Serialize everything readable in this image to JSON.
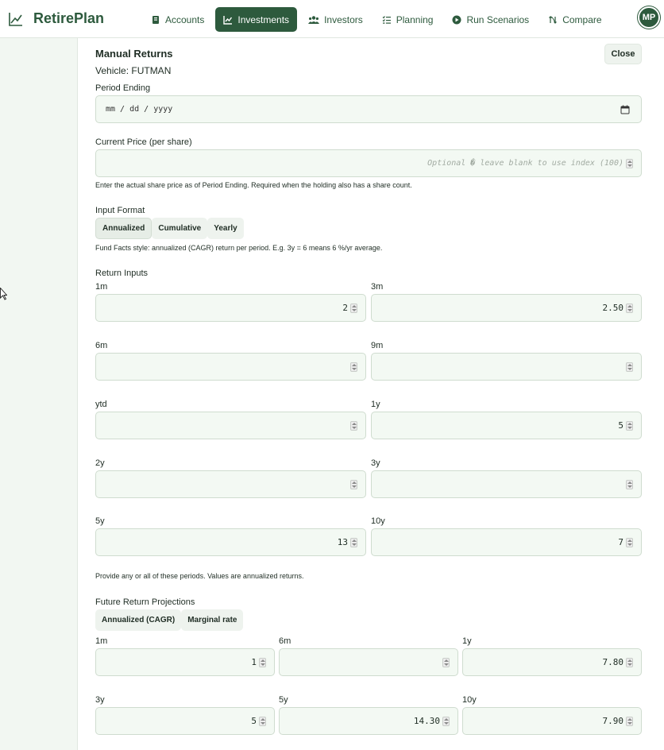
{
  "app": {
    "brand": "RetirePlan",
    "avatar_initials": "MP"
  },
  "nav": {
    "items": [
      {
        "label": "Accounts",
        "icon": "accounts-icon"
      },
      {
        "label": "Investments",
        "icon": "chart-icon",
        "active": true
      },
      {
        "label": "Investors",
        "icon": "users-icon"
      },
      {
        "label": "Planning",
        "icon": "checklist-icon"
      },
      {
        "label": "Run Scenarios",
        "icon": "play-icon"
      },
      {
        "label": "Compare",
        "icon": "compare-icon"
      }
    ]
  },
  "panel": {
    "title": "Manual Returns",
    "close_label": "Close",
    "vehicle": "Vehicle: FUTMAN",
    "period_ending": {
      "label": "Period Ending",
      "value": "mm / dd / yyyy"
    },
    "current_price": {
      "label": "Current Price (per share)",
      "placeholder": "Optional � leave blank to use index (100)",
      "help": "Enter the actual share price as of Period Ending. Required when the holding also has a share count."
    },
    "input_format": {
      "label": "Input Format",
      "options": [
        "Annualized",
        "Cumulative",
        "Yearly"
      ],
      "selected": "Annualized",
      "help": "Fund Facts style: annualized (CAGR) return per period. E.g. 3y = 6 means 6 %/yr average."
    },
    "return_inputs": {
      "label": "Return Inputs",
      "fields": [
        {
          "label": "1m",
          "value": "2"
        },
        {
          "label": "3m",
          "value": "2.50"
        },
        {
          "label": "6m",
          "value": ""
        },
        {
          "label": "9m",
          "value": ""
        },
        {
          "label": "ytd",
          "value": ""
        },
        {
          "label": "1y",
          "value": "5"
        },
        {
          "label": "2y",
          "value": ""
        },
        {
          "label": "3y",
          "value": ""
        },
        {
          "label": "5y",
          "value": "13"
        },
        {
          "label": "10y",
          "value": "7"
        }
      ],
      "help": "Provide any or all of these periods. Values are annualized returns."
    },
    "projections": {
      "label": "Future Return Projections",
      "options": [
        "Annualized (CAGR)",
        "Marginal rate"
      ],
      "fields": [
        {
          "label": "1m",
          "value": "1"
        },
        {
          "label": "6m",
          "value": ""
        },
        {
          "label": "1y",
          "value": "7.80"
        },
        {
          "label": "3y",
          "value": "5"
        },
        {
          "label": "5y",
          "value": "14.30"
        },
        {
          "label": "10y",
          "value": "7.90"
        }
      ]
    }
  },
  "colors": {
    "brand": "#2d5a3d",
    "field_bg": "#f3f9f3",
    "page_bg": "#f2f7f2"
  }
}
